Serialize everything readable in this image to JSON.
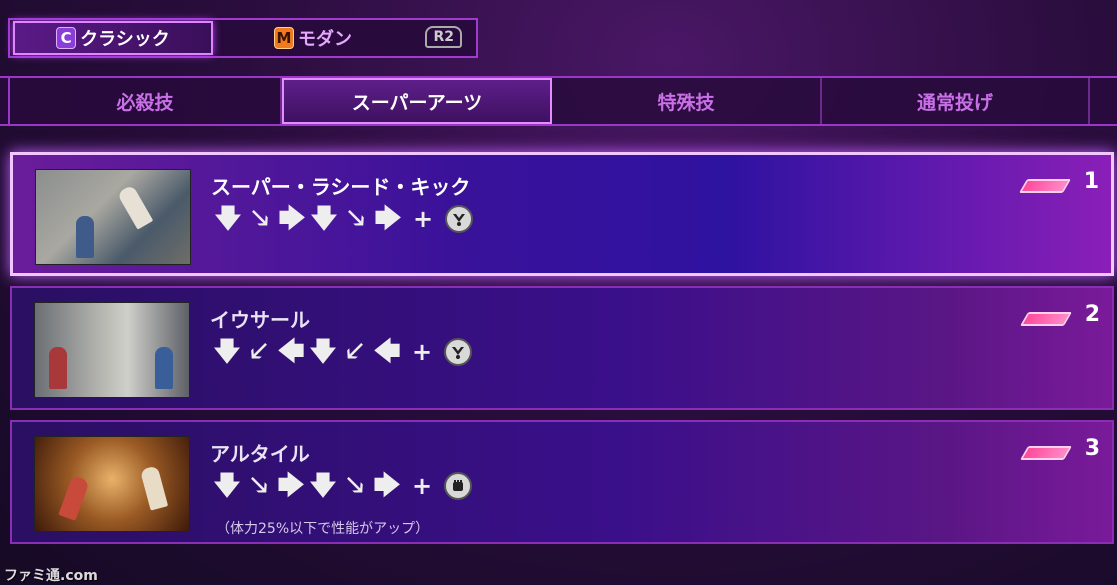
{
  "control_types": {
    "classic": {
      "badge": "C",
      "label": "クラシック"
    },
    "modern": {
      "badge": "M",
      "label": "モダン"
    },
    "switch_hint": "R2"
  },
  "tabs": [
    {
      "label": "必殺技"
    },
    {
      "label": "スーパーアーツ"
    },
    {
      "label": "特殊技"
    },
    {
      "label": "通常投げ"
    }
  ],
  "moves": [
    {
      "name": "スーパー・ラシード・キック",
      "command": [
        "down-arrow",
        "down-right-arrow",
        "right-arrow",
        "down-arrow",
        "down-right-arrow",
        "right-arrow"
      ],
      "plus": "+",
      "button": "kick-icon",
      "level": "1",
      "note": ""
    },
    {
      "name": "イウサール",
      "command": [
        "down-arrow",
        "down-left-arrow",
        "left-arrow",
        "down-arrow",
        "down-left-arrow",
        "left-arrow"
      ],
      "plus": "+",
      "button": "kick-icon",
      "level": "2",
      "note": ""
    },
    {
      "name": "アルタイル",
      "command": [
        "down-arrow",
        "down-right-arrow",
        "right-arrow",
        "down-arrow",
        "down-right-arrow",
        "right-arrow"
      ],
      "plus": "+",
      "button": "punch-icon",
      "level": "3",
      "note": "（体力25%以下で性能がアップ）"
    }
  ],
  "watermark": "ファミ通.com",
  "colors": {
    "accent": "#b040f0",
    "gauge": "#ff4a9a"
  }
}
